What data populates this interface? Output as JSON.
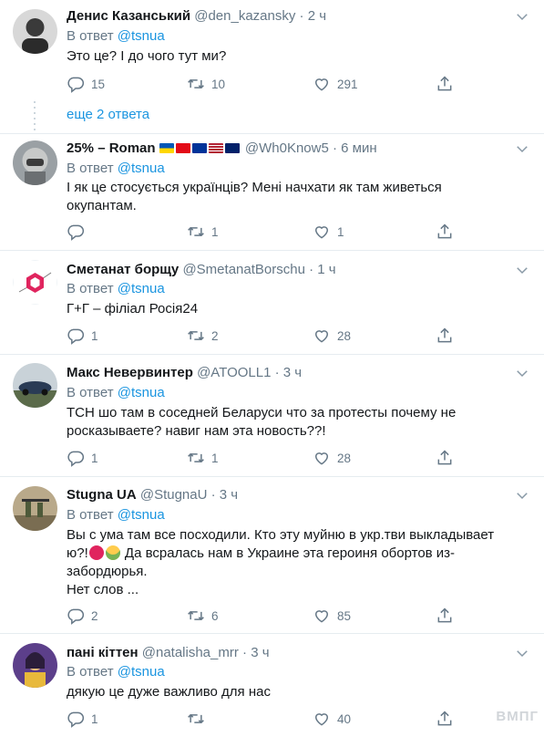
{
  "reply_prefix": "В ответ",
  "tweets": [
    {
      "name": "Денис Казанський",
      "handle": "@den_kazansky",
      "time": "2 ч",
      "reply_to": "@tsnua",
      "lines": [
        "Это це? І до чого тут ми?"
      ],
      "replies": "15",
      "retweets": "10",
      "likes": "291"
    },
    {
      "name": "25% – Roman",
      "handle": "@Wh0Know5",
      "time": "6 мин",
      "reply_to": "@tsnua",
      "lines": [
        "І як це стосується українців? Мені начхати як там живеться",
        "окупантам."
      ],
      "replies": "",
      "retweets": "1",
      "likes": "1"
    },
    {
      "name": "Сметанат борщу",
      "handle": "@SmetanatBorschu",
      "time": "1 ч",
      "reply_to": "@tsnua",
      "lines": [
        "Г+Г – філіал Росія24"
      ],
      "replies": "1",
      "retweets": "2",
      "likes": "28"
    },
    {
      "name": "Макс Невервинтер",
      "handle": "@ATOOLL1",
      "time": "3 ч",
      "reply_to": "@tsnua",
      "lines": [
        "ТСН шо там в соседней Беларуси что за протесты почему не",
        "росказываете? навиг нам эта новость??!"
      ],
      "replies": "1",
      "retweets": "1",
      "likes": "28"
    },
    {
      "name": "Stugna UA",
      "handle": "@StugnaU",
      "time": "3 ч",
      "reply_to": "@tsnua",
      "lines": [
        "Вы с ума там все посходили. Кто эту муйню в укр.тви выкладывает",
        "ю?!",
        " Да всралась нам в Украине эта героиня обортов из-",
        "забордюрья.",
        "Нет слов ..."
      ],
      "replies": "2",
      "retweets": "6",
      "likes": "85"
    },
    {
      "name": "пані кіттен",
      "handle": "@natalisha_mrr",
      "time": "3 ч",
      "reply_to": "@tsnua",
      "lines": [
        "дякую це дуже важливо для нас"
      ],
      "replies": "1",
      "retweets": "",
      "likes": "40"
    }
  ],
  "more_replies": "еще 2 ответа",
  "watermark": "ВМПГ",
  "colors": {
    "link": "#1b95e0",
    "muted": "#657786",
    "text": "#14171a",
    "border": "#e6ecf0"
  },
  "icons": [
    "reply-icon",
    "retweet-icon",
    "like-icon",
    "share-icon",
    "caret-down-icon"
  ]
}
